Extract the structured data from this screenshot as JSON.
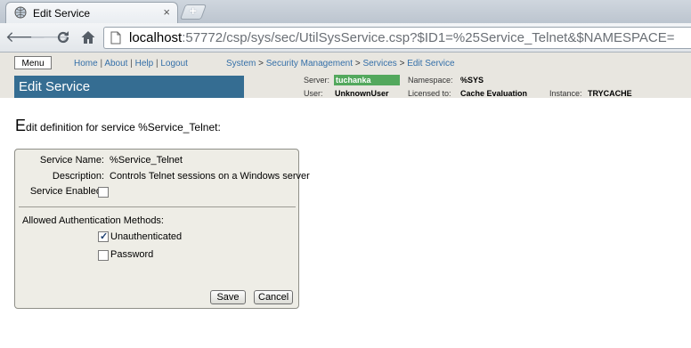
{
  "browser": {
    "tab_title": "Edit Service",
    "tab_close": "×",
    "new_tab": "+",
    "url_host": "localhost",
    "url_rest": ":57772/csp/sys/sec/UtilSysService.csp?$ID1=%25Service_Telnet&$NAMESPACE="
  },
  "header": {
    "menu_label": "Menu",
    "links": {
      "home": "Home",
      "about": "About",
      "help": "Help",
      "logout": "Logout",
      "sep": "|"
    },
    "breadcrumbs": {
      "system": "System",
      "security": "Security Management",
      "services": "Services",
      "edit": "Edit Service",
      "sep": ">"
    },
    "page_title": "Edit Service",
    "server_label": "Server:",
    "server_value": "tuchanka",
    "namespace_label": "Namespace:",
    "namespace_value": "%SYS",
    "user_label": "User:",
    "user_value": "UnknownUser",
    "licensed_label": "Licensed to:",
    "licensed_value": "Cache Evaluation",
    "instance_label": "Instance:",
    "instance_value": "TRYCACHE"
  },
  "content": {
    "heading_first": "E",
    "heading_rest": "dit definition for service %Service_Telnet:"
  },
  "form": {
    "service_name_label": "Service Name:",
    "service_name_value": "%Service_Telnet",
    "description_label": "Description:",
    "description_value": "Controls Telnet sessions on a Windows server",
    "enabled_label": "Service Enabled:",
    "enabled_checked": false,
    "auth_label": "Allowed Authentication Methods:",
    "unauthenticated_label": "Unauthenticated",
    "unauthenticated_checked": true,
    "password_label": "Password",
    "password_checked": false,
    "save_label": "Save",
    "cancel_label": "Cancel"
  }
}
